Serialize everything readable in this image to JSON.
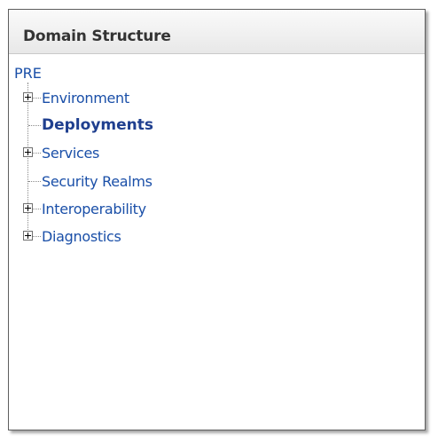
{
  "panel": {
    "title": "Domain Structure"
  },
  "tree": {
    "root": "PRE",
    "nodes": [
      {
        "label": "Environment",
        "expandable": true,
        "selected": false
      },
      {
        "label": "Deployments",
        "expandable": false,
        "selected": true
      },
      {
        "label": "Services",
        "expandable": true,
        "selected": false
      },
      {
        "label": "Security Realms",
        "expandable": false,
        "selected": false
      },
      {
        "label": "Interoperability",
        "expandable": true,
        "selected": false
      },
      {
        "label": "Diagnostics",
        "expandable": true,
        "selected": false
      }
    ]
  },
  "colors": {
    "link": "#1a4fa8",
    "selected_link": "#1f3f8f",
    "header_text": "#333333",
    "border": "#5e5e5e"
  }
}
